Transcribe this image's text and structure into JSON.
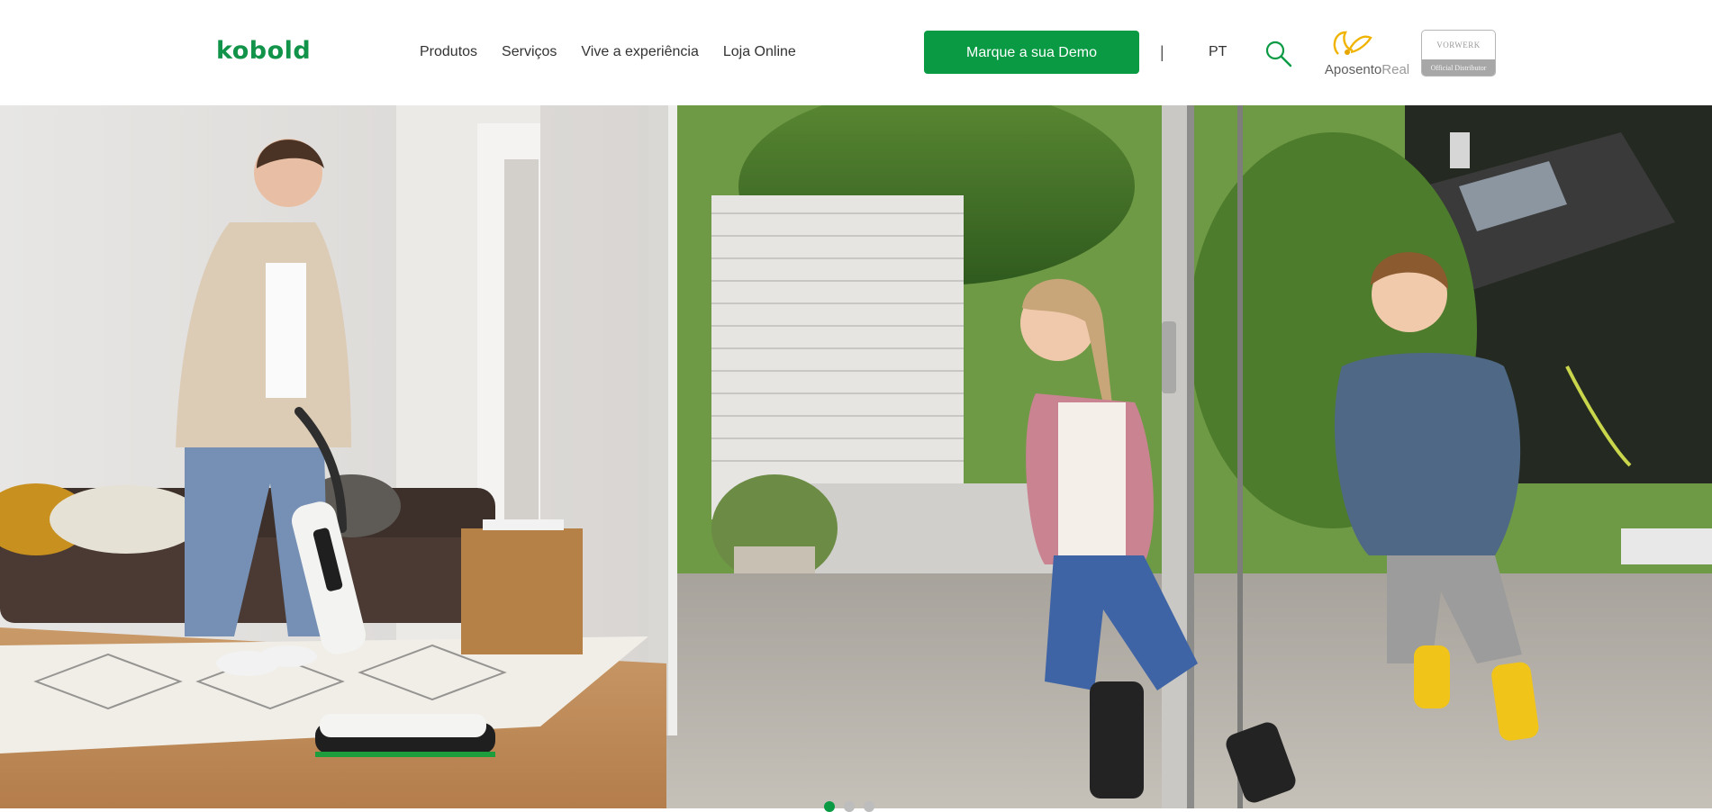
{
  "header": {
    "logo_text": "kobold",
    "nav": [
      {
        "label": "Produtos"
      },
      {
        "label": "Serviços"
      },
      {
        "label": "Vive a experiência"
      },
      {
        "label": "Loja Online"
      }
    ],
    "cta_label": "Marque a sua Demo",
    "separator": "|",
    "language": "PT",
    "search_icon": "search-icon",
    "partner_logo": {
      "part1": "Aposento",
      "part2": "Real"
    },
    "badge": {
      "top": "VORWERK",
      "bottom": "Official Distributor"
    }
  },
  "hero": {
    "image": "woman-vacuuming-children-running",
    "slides": 3,
    "active_slide": 1
  },
  "colors": {
    "brand_green": "#0a9a43",
    "logo_green": "#12934a",
    "nav_text": "#333333"
  }
}
